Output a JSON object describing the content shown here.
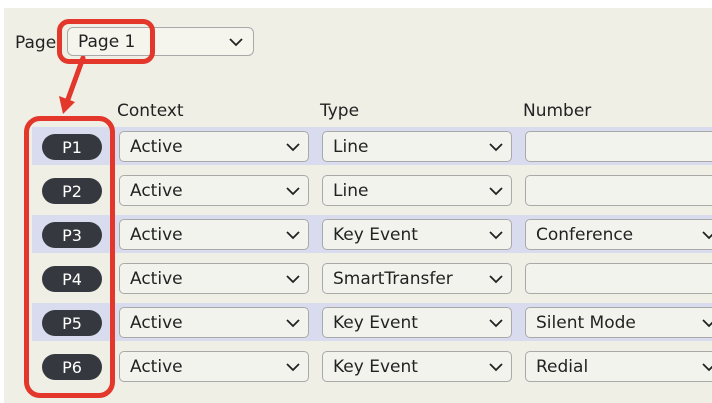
{
  "page_selector": {
    "label": "Page",
    "value": "Page 1"
  },
  "columns": {
    "context": "Context",
    "type": "Type",
    "number": "Number"
  },
  "rows": [
    {
      "key": "P1",
      "context": "Active",
      "type": "Line",
      "number": ""
    },
    {
      "key": "P2",
      "context": "Active",
      "type": "Line",
      "number": ""
    },
    {
      "key": "P3",
      "context": "Active",
      "type": "Key Event",
      "number": "Conference"
    },
    {
      "key": "P4",
      "context": "Active",
      "type": "SmartTransfer",
      "number": ""
    },
    {
      "key": "P5",
      "context": "Active",
      "type": "Key Event",
      "number": "Silent Mode"
    },
    {
      "key": "P6",
      "context": "Active",
      "type": "Key Event",
      "number": "Redial"
    }
  ],
  "colors": {
    "highlight": "#e2372a",
    "row_shade": "#d9dcef",
    "key_badge": "#35393f",
    "panel": "#efefe6"
  },
  "icons": {
    "dropdown": "chevron-down-icon",
    "pointer": "arrow-down-icon"
  }
}
